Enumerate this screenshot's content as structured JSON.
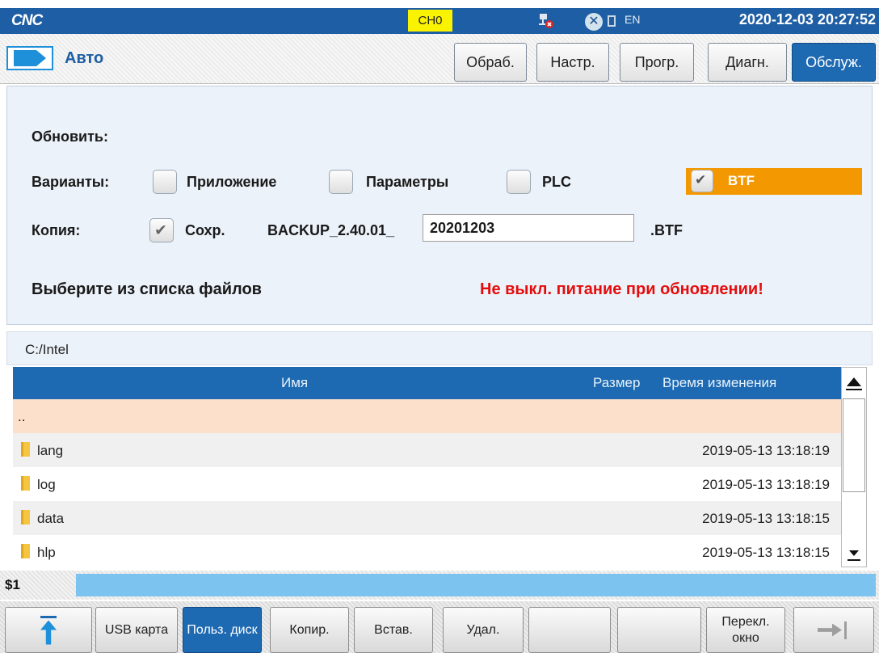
{
  "status": {
    "logo": "CNC",
    "channel": "CH0",
    "lang": "EN",
    "datetime": "2020-12-03 20:27:52"
  },
  "header": {
    "mode": "Авто",
    "tabs": [
      "Обраб.",
      "Настр.",
      "Прогр.",
      "Диагн.",
      "Обслуж."
    ]
  },
  "update": {
    "title": "Обновить:",
    "options_label": "Варианты:",
    "options": [
      {
        "label": "Приложение",
        "checked": false
      },
      {
        "label": "Параметры",
        "checked": false
      },
      {
        "label": "PLC",
        "checked": false
      },
      {
        "label": "BTF",
        "checked": true
      }
    ],
    "copy_label": "Копия:",
    "save_label": "Сохр.",
    "save_checked": true,
    "backup_prefix": "BACKUP_2.40.01_",
    "backup_name": "20201203",
    "extension": ".BTF",
    "choose_text": "Выберите из списка файлов",
    "warning": "Не выкл. питание при обновлении!"
  },
  "files": {
    "path": "C:/Intel",
    "columns": {
      "name": "Имя",
      "size": "Размер",
      "time": "Время изменения"
    },
    "parent": "..",
    "rows": [
      {
        "name": "lang",
        "time": "2019-05-13 13:18:19"
      },
      {
        "name": "log",
        "time": "2019-05-13 13:18:19"
      },
      {
        "name": "data",
        "time": "2019-05-13 13:18:15"
      },
      {
        "name": "hlp",
        "time": "2019-05-13 13:18:15"
      }
    ]
  },
  "command": {
    "prompt": "$1"
  },
  "softkeys": [
    "USB карта",
    "Польз. диск",
    "Копир.",
    "Встав.",
    "Удал.",
    "",
    "",
    "Перекл. окно"
  ],
  "colors": {
    "accent": "#1e6ab2",
    "warning": "#e40d0d",
    "highlight": "#f39800",
    "channel": "#f9f200"
  }
}
